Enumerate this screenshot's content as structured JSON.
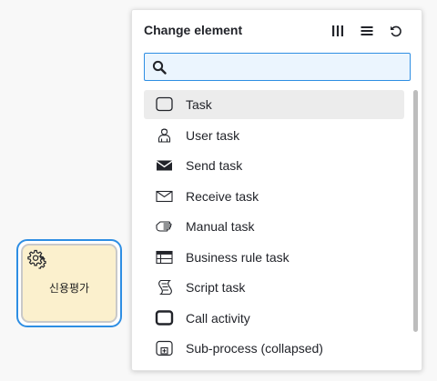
{
  "canvas": {
    "task": {
      "label": "신용평가",
      "icon": "gear-icon"
    }
  },
  "popup": {
    "title": "Change element",
    "header_buttons": [
      {
        "name": "columns-view-icon"
      },
      {
        "name": "list-view-icon"
      },
      {
        "name": "undo-icon"
      }
    ],
    "search": {
      "value": "",
      "placeholder": ""
    },
    "entries": [
      {
        "label": "Task",
        "icon": "task-icon",
        "active": true
      },
      {
        "label": "User task",
        "icon": "user-task-icon"
      },
      {
        "label": "Send task",
        "icon": "send-task-icon"
      },
      {
        "label": "Receive task",
        "icon": "receive-task-icon"
      },
      {
        "label": "Manual task",
        "icon": "manual-task-icon"
      },
      {
        "label": "Business rule task",
        "icon": "business-rule-task-icon"
      },
      {
        "label": "Script task",
        "icon": "script-task-icon"
      },
      {
        "label": "Call activity",
        "icon": "call-activity-icon"
      },
      {
        "label": "Sub-process (collapsed)",
        "icon": "sub-process-collapsed-icon"
      }
    ]
  },
  "colors": {
    "accent": "#2e8ee3",
    "task_fill": "#fbf0cd",
    "search_bg": "#ebf5fe",
    "active_entry_bg": "#ececec"
  }
}
